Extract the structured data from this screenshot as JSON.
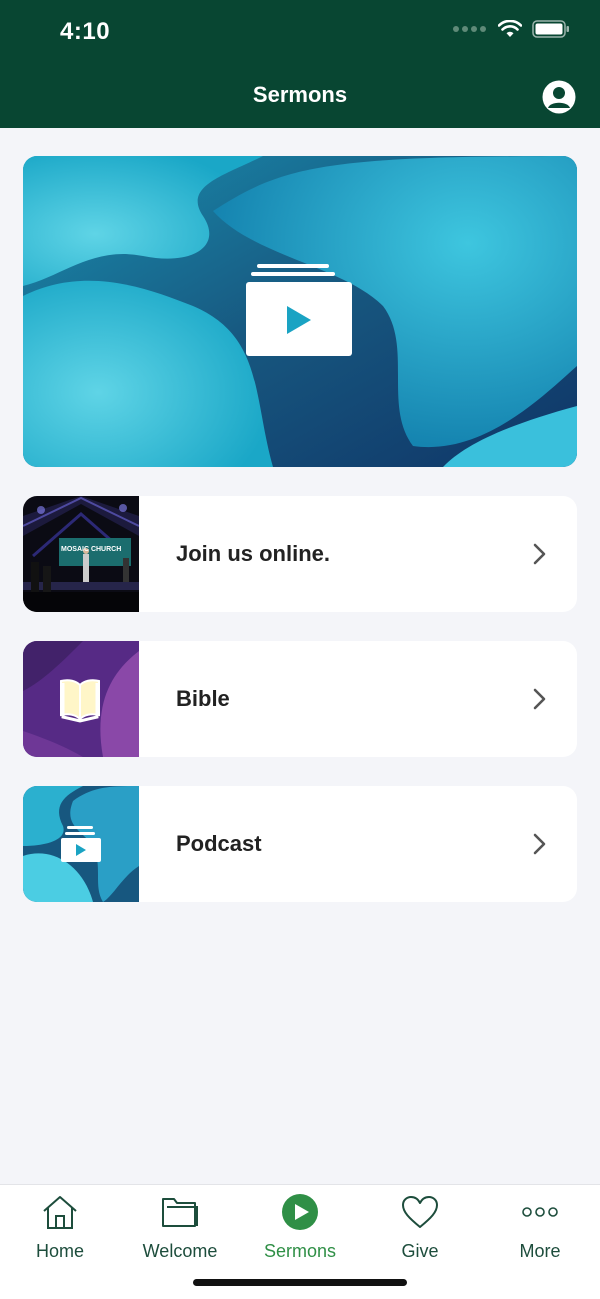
{
  "status_bar": {
    "time": "4:10"
  },
  "header": {
    "title": "Sermons"
  },
  "cards": [
    {
      "label": "Join us online.",
      "thumb_text": "MOSAIC CHURCH"
    },
    {
      "label": "Bible"
    },
    {
      "label": "Podcast"
    }
  ],
  "tab_bar": {
    "items": [
      {
        "label": "Home",
        "icon": "house-icon"
      },
      {
        "label": "Welcome",
        "icon": "folder-icon"
      },
      {
        "label": "Sermons",
        "icon": "play-circle-icon"
      },
      {
        "label": "Give",
        "icon": "heart-icon"
      },
      {
        "label": "More",
        "icon": "ellipsis-icon"
      }
    ],
    "active": "Sermons"
  },
  "colors": {
    "header_bg": "#084632",
    "active_tab": "#2f8f46",
    "inactive_tab": "#1d4d3c",
    "page_bg": "#f4f5f9"
  }
}
